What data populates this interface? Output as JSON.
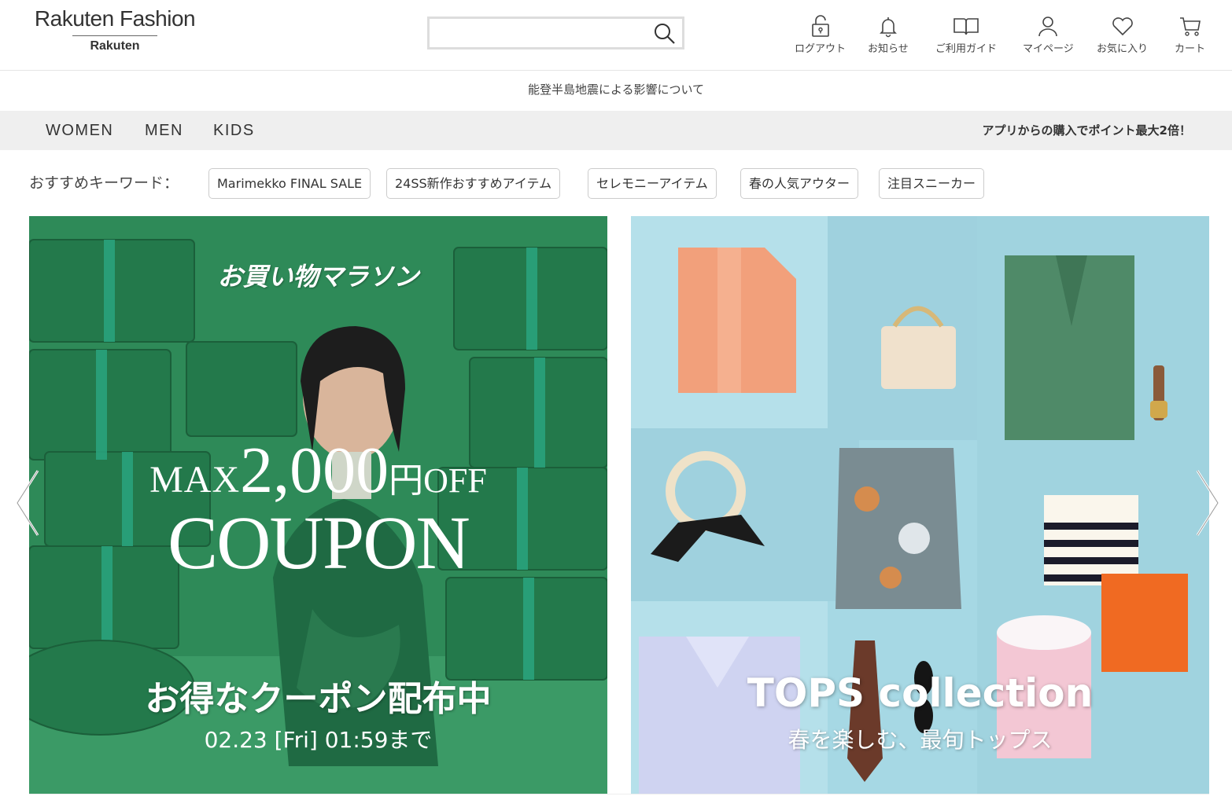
{
  "header": {
    "logo_main": "Rakuten Fashion",
    "logo_sub": "Rakuten",
    "search_placeholder": "",
    "utilities": [
      {
        "label": "ログアウト",
        "icon": "lock-icon"
      },
      {
        "label": "お知らせ",
        "icon": "bell-icon"
      },
      {
        "label": "ご利用ガイド",
        "icon": "book-icon"
      },
      {
        "label": "マイページ",
        "icon": "user-icon"
      },
      {
        "label": "お気に入り",
        "icon": "heart-icon"
      },
      {
        "label": "カート",
        "icon": "cart-icon"
      }
    ]
  },
  "notice": "能登半島地震による影響について",
  "categories": [
    "WOMEN",
    "MEN",
    "KIDS"
  ],
  "app_promo": "アプリからの購入でポイント最大2倍！",
  "keywords": {
    "label": "おすすめキーワード：",
    "items": [
      "Marimekko FINAL SALE",
      "24SS新作おすすめアイテム",
      "セレモニーアイテム",
      "春の人気アウター",
      "注目スニーカー"
    ]
  },
  "banners": {
    "left": {
      "heading": "お買い物マラソン",
      "max_prefix": "MAX",
      "amount": "2,000",
      "suffix": "円OFF",
      "coupon": "COUPON",
      "subtitle": "お得なクーポン配布中",
      "date": "02.23 [Fri] 01:59まで",
      "bg_color": "#2f8a5a"
    },
    "right": {
      "title": "TOPS collection",
      "subtitle": "春を楽しむ、最旬トップス",
      "bg_color": "#a9dbe6"
    }
  },
  "colors": {
    "nav_bg": "#efefef",
    "border": "#dddddd"
  }
}
